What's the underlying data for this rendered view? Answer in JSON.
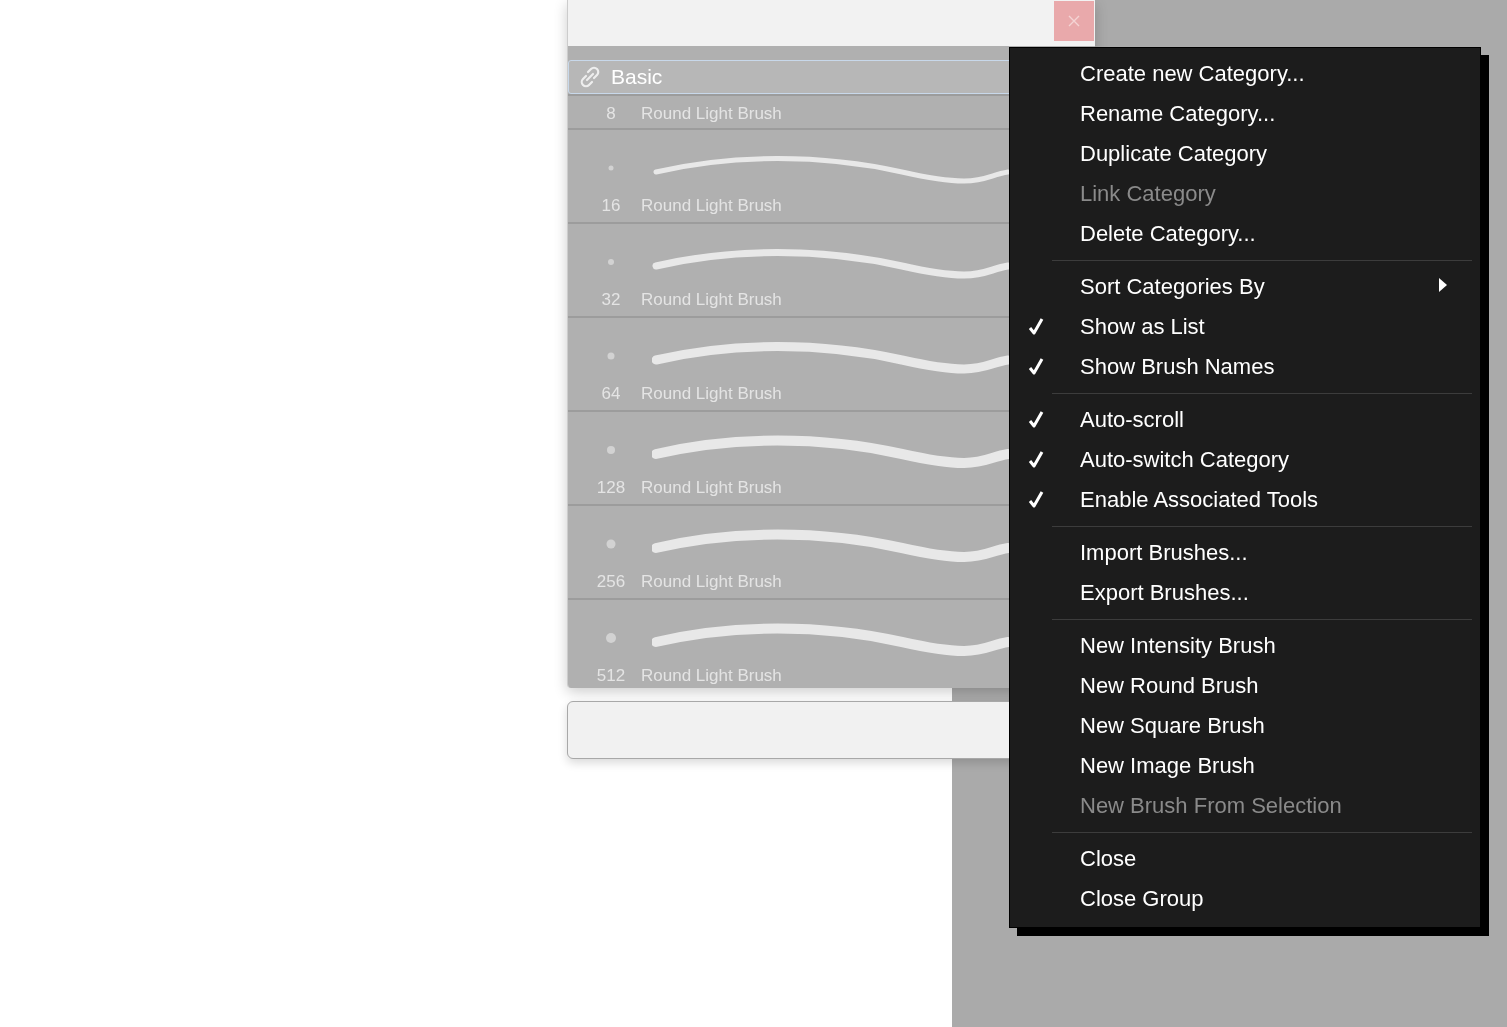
{
  "brush_panel": {
    "category": {
      "name": "Basic"
    },
    "brushes": [
      {
        "size": "8",
        "name": "Round Light Brush"
      },
      {
        "size": "16",
        "name": "Round Light Brush"
      },
      {
        "size": "32",
        "name": "Round Light Brush"
      },
      {
        "size": "64",
        "name": "Round Light Brush"
      },
      {
        "size": "128",
        "name": "Round Light Brush"
      },
      {
        "size": "256",
        "name": "Round Light Brush"
      },
      {
        "size": "512",
        "name": "Round Light Brush"
      }
    ]
  },
  "context_menu": {
    "items": [
      {
        "kind": "item",
        "label": "Create new Category...",
        "checked": false,
        "disabled": false
      },
      {
        "kind": "item",
        "label": "Rename Category...",
        "checked": false,
        "disabled": false
      },
      {
        "kind": "item",
        "label": "Duplicate Category",
        "checked": false,
        "disabled": false
      },
      {
        "kind": "item",
        "label": "Link Category",
        "checked": false,
        "disabled": true
      },
      {
        "kind": "item",
        "label": "Delete Category...",
        "checked": false,
        "disabled": false
      },
      {
        "kind": "separator"
      },
      {
        "kind": "submenu",
        "label": "Sort Categories By",
        "checked": false,
        "disabled": false
      },
      {
        "kind": "item",
        "label": "Show as List",
        "checked": true,
        "disabled": false
      },
      {
        "kind": "item",
        "label": "Show Brush Names",
        "checked": true,
        "disabled": false
      },
      {
        "kind": "separator"
      },
      {
        "kind": "item",
        "label": "Auto-scroll",
        "checked": true,
        "disabled": false
      },
      {
        "kind": "item",
        "label": "Auto-switch Category",
        "checked": true,
        "disabled": false
      },
      {
        "kind": "item",
        "label": "Enable Associated Tools",
        "checked": true,
        "disabled": false
      },
      {
        "kind": "separator"
      },
      {
        "kind": "item",
        "label": "Import Brushes...",
        "checked": false,
        "disabled": false
      },
      {
        "kind": "item",
        "label": "Export Brushes...",
        "checked": false,
        "disabled": false
      },
      {
        "kind": "separator"
      },
      {
        "kind": "item",
        "label": "New Intensity Brush",
        "checked": false,
        "disabled": false
      },
      {
        "kind": "item",
        "label": "New Round Brush",
        "checked": false,
        "disabled": false
      },
      {
        "kind": "item",
        "label": "New Square Brush",
        "checked": false,
        "disabled": false
      },
      {
        "kind": "item",
        "label": "New Image Brush",
        "checked": false,
        "disabled": false
      },
      {
        "kind": "item",
        "label": "New Brush From Selection",
        "checked": false,
        "disabled": true
      },
      {
        "kind": "separator"
      },
      {
        "kind": "item",
        "label": "Close",
        "checked": false,
        "disabled": false
      },
      {
        "kind": "item",
        "label": "Close Group",
        "checked": false,
        "disabled": false
      }
    ]
  }
}
